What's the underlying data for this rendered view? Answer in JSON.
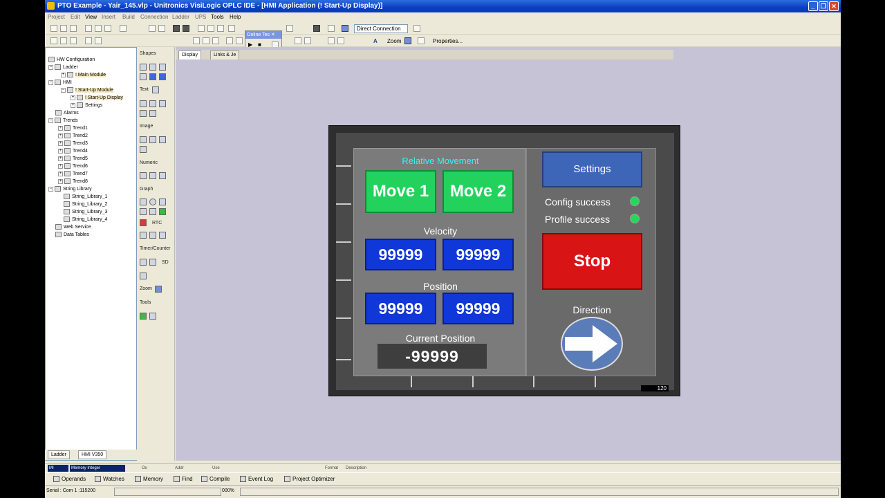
{
  "window": {
    "title": "PTO Example - Yair_145.vlp - Unitronics VisiLogic OPLC IDE - [HMI Application (! Start-Up Display)]"
  },
  "menu": [
    "Project",
    "Edit",
    "View",
    "Insert",
    "Build",
    "Connection",
    "Ladder",
    "UPS",
    "Tools",
    "Help"
  ],
  "toolbar": {
    "connection_dropdown": "Direct Connection",
    "zoom_label": "Zoom",
    "properties_label": "Properties..."
  },
  "online_toolbar": {
    "title": "Online Tes"
  },
  "tree": {
    "items": [
      {
        "label": "HW Configuration"
      },
      {
        "label": "Ladder"
      },
      {
        "label": "! Main Module"
      },
      {
        "label": "HMI"
      },
      {
        "label": "! Start-Up Module"
      },
      {
        "label": "! Start-Up Display"
      },
      {
        "label": "Settings"
      },
      {
        "label": "Alarms"
      },
      {
        "label": "Trends"
      },
      {
        "label": "Trend1"
      },
      {
        "label": "Trend2"
      },
      {
        "label": "Trend3"
      },
      {
        "label": "Trend4"
      },
      {
        "label": "Trend5"
      },
      {
        "label": "Trend6"
      },
      {
        "label": "Trend7"
      },
      {
        "label": "Trend8"
      },
      {
        "label": "String Library"
      },
      {
        "label": "String_Library_1"
      },
      {
        "label": "String_Library_2"
      },
      {
        "label": "String_Library_3"
      },
      {
        "label": "String_Library_4"
      },
      {
        "label": "Web Service"
      },
      {
        "label": "Data Tables"
      }
    ],
    "tabs": [
      "Ladder",
      "HMI V350"
    ]
  },
  "toolbox": {
    "sections": [
      "Shapes",
      "Text",
      "Image",
      "Numeric",
      "Graph",
      "Timer/Counter",
      "Zoom",
      "Tools"
    ],
    "rtc_label": "RTC",
    "sd_label": "SD"
  },
  "doc_tabs": [
    "Display",
    "Links & Je"
  ],
  "hmi": {
    "relative_movement": "Relative Movement",
    "move1": "Move 1",
    "move2": "Move 2",
    "velocity_label": "Velocity",
    "velocity_values": [
      "99999",
      "99999"
    ],
    "position_label": "Position",
    "position_values": [
      "99999",
      "99999"
    ],
    "current_position_label": "Current Position",
    "current_position_value": "-99999",
    "settings_button": "Settings",
    "config_success": "Config success",
    "profile_success": "Profile success",
    "stop_button": "Stop",
    "direction_label": "Direction",
    "screen_number": "120",
    "colors": {
      "green": "#22d25c",
      "blue": "#1037d8",
      "red": "#d81414",
      "cyan": "#3df0f0",
      "led": "#24d85a"
    }
  },
  "props_bar": {
    "type": "MI",
    "operand": "Memory Integer",
    "columns": [
      "Ox",
      "Addr",
      "Use",
      "Format",
      "Description"
    ]
  },
  "bottom_tabs": [
    "Operands",
    "Watches",
    "Memory",
    "Find",
    "Compile",
    "Event Log",
    "Project Optimizer"
  ],
  "status": {
    "connection": "Serial : Com 1 :115200",
    "progress": "000%"
  }
}
